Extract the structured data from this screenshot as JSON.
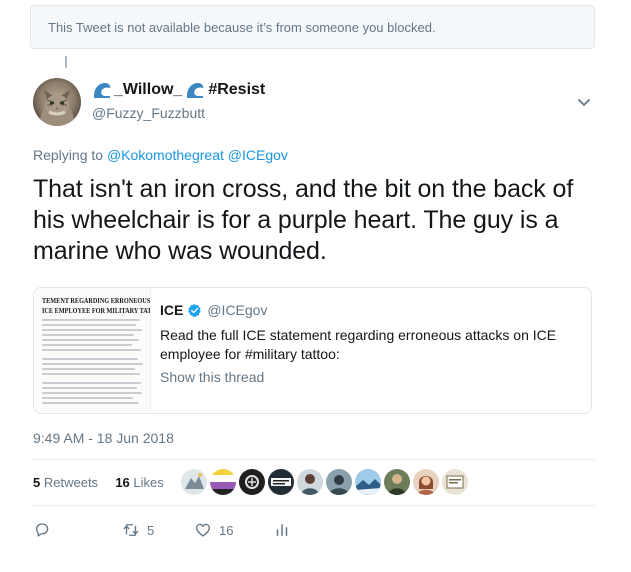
{
  "blocked_notice": "This Tweet is not available because it’s from someone you blocked.",
  "author": {
    "name_part1": "_Willow_",
    "name_part2": "#Resist",
    "handle": "@Fuzzy_Fuzzbutt",
    "name_icon": "water-wave-emoji",
    "avatar": "cat-photo"
  },
  "replying": {
    "prefix": "Replying to ",
    "mention1": "@Kokomothegreat",
    "mention2": "@ICEgov"
  },
  "tweet_text": "That isn't an iron cross, and the bit on the back of his wheelchair is for a purple heart. The guy is a marine who was wounded.",
  "quote": {
    "image_heading_line1": "TEMENT REGARDING ERRONEOUS A",
    "image_heading_line2": "ICE EMPLOYEE FOR MILITARY TATT",
    "name": "ICE",
    "handle": "@ICEgov",
    "text": "Read the full ICE statement regarding erroneous attacks on ICE employee for #military tattoo:",
    "show_thread": "Show this thread"
  },
  "timestamp": "9:49 AM - 18 Jun 2018",
  "stats": {
    "retweets_count": "5",
    "retweets_label": "Retweets",
    "likes_count": "16",
    "likes_label": "Likes"
  },
  "actions": {
    "retweet_count": "5",
    "like_count": "16"
  },
  "colors": {
    "link": "#1b95e0",
    "secondary_text": "#657786",
    "primary_text": "#14171a",
    "border": "#e1e8ed"
  }
}
